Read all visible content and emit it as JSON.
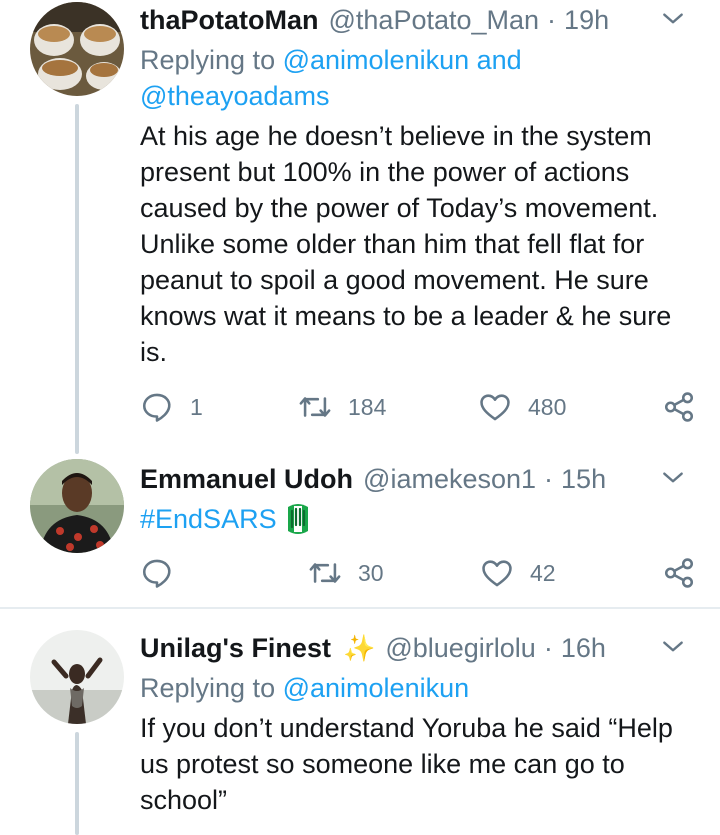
{
  "tweets": [
    {
      "name": "thaPotatoMan",
      "handle": "@thaPotato_Man",
      "separator": "·",
      "time": "19h",
      "replying_prefix": "Replying to",
      "replying_line1": "@animolenikun and",
      "replying_line2": "@theayoadams",
      "body_lines": [
        "At his age he doesn’t believe in the system",
        "present but 100% in the power of actions",
        "caused by the power of Today’s movement.",
        "Unlike some older than him that fell flat for",
        "peanut to spoil a good movement. He sure",
        "knows wat it means to be a leader & he sure",
        "is."
      ],
      "replies": "1",
      "retweets": "184",
      "likes": "480"
    },
    {
      "name": "Emmanuel Udoh",
      "handle": "@iamekeson1",
      "separator": "·",
      "time": "15h",
      "body": "#EndSARS",
      "replies": "",
      "retweets": "30",
      "likes": "42"
    },
    {
      "name": "Unilag's Finest",
      "name_emoji": "✨",
      "handle": "@bluegirlolu",
      "separator": "·",
      "time": "16h",
      "replying_prefix": "Replying to",
      "replying_line1": "@animolenikun",
      "body_lines": [
        "If you don’t understand Yoruba he said “Help",
        "us protest so someone like me can go to",
        "school”"
      ]
    }
  ],
  "colors": {
    "text": "#14171a",
    "secondary": "#657786",
    "link": "#1da1f2",
    "thread_line": "#ccd6dd",
    "divider": "#e6ecf0"
  }
}
